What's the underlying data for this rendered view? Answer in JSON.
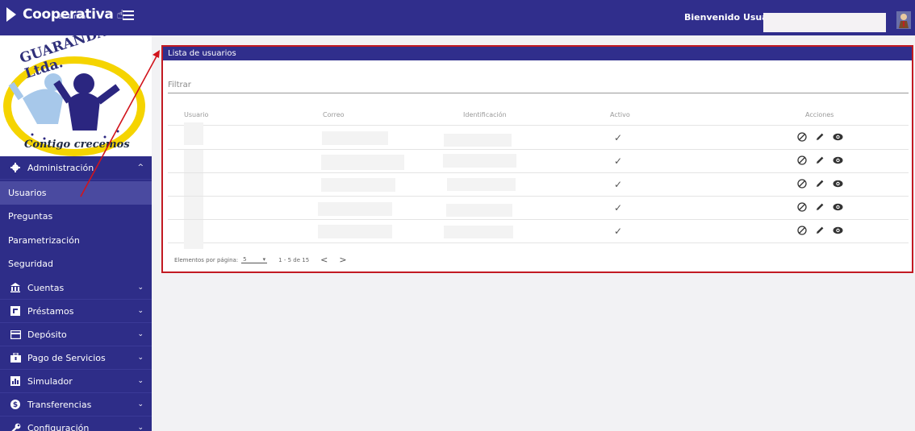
{
  "header": {
    "brand_name": "Cooperativa",
    "brand_sub": "en Línea",
    "welcome": "Bienvenido Usuario:"
  },
  "logo": {
    "title": "GUARANDA Ltda.",
    "slogan": "Contigo crecemos"
  },
  "sidebar": {
    "items": [
      {
        "label": "Administración",
        "icon": "gear-icon",
        "chevron": "^"
      },
      {
        "label": "Usuarios"
      },
      {
        "label": "Preguntas"
      },
      {
        "label": "Parametrización"
      },
      {
        "label": "Seguridad"
      },
      {
        "label": "Cuentas",
        "icon": "bank-icon",
        "chevron": "⌄"
      },
      {
        "label": "Préstamos",
        "icon": "loan-icon",
        "chevron": "⌄"
      },
      {
        "label": "Depósito",
        "icon": "card-icon",
        "chevron": "⌄"
      },
      {
        "label": "Pago de Servicios",
        "icon": "service-icon",
        "chevron": "⌄"
      },
      {
        "label": "Simulador",
        "icon": "chart-icon",
        "chevron": "⌄"
      },
      {
        "label": "Transferencias",
        "icon": "transfer-icon",
        "chevron": "⌄"
      },
      {
        "label": "Configuración",
        "icon": "wrench-icon",
        "chevron": "⌄"
      }
    ]
  },
  "card": {
    "title": "Lista de usuarios",
    "filter_placeholder": "Filtrar",
    "columns": [
      "Usuario",
      "Correo",
      "Identificación",
      "Activo",
      "Acciones"
    ],
    "rows": [
      {
        "activo": "✓"
      },
      {
        "activo": "✓"
      },
      {
        "activo": "✓"
      },
      {
        "activo": "✓"
      },
      {
        "activo": "✓"
      }
    ],
    "paginator": {
      "label": "Elementos por página:",
      "page_size": "5",
      "range": "1 - 5 de 15",
      "prev": "<",
      "next": ">"
    }
  },
  "colors": {
    "primary": "#302e8c",
    "highlight": "#c21a22"
  }
}
